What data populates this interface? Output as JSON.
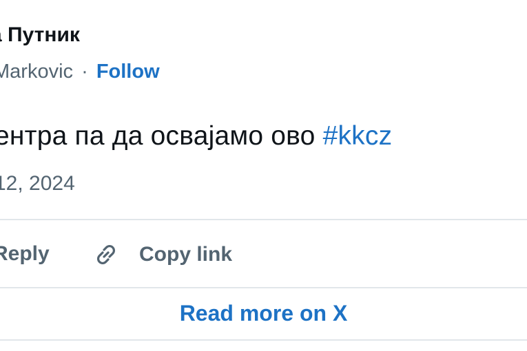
{
  "author": {
    "display_name": "а Путник",
    "handle": "Markovic",
    "separator": "·",
    "follow_label": "Follow"
  },
  "tweet": {
    "text": "ентра па да освајамо ово ",
    "hashtag": "#kkcz",
    "date": "12, 2024"
  },
  "actions": {
    "reply_label": "Reply",
    "copy_link_label": "Copy link",
    "copy_link_icon": "link-icon"
  },
  "footer": {
    "read_more_label": "Read more on X"
  },
  "colors": {
    "link_blue": "#1d72c5",
    "text_dark": "#0f1419",
    "text_gray": "#536471",
    "divider": "#e1e6ea"
  }
}
